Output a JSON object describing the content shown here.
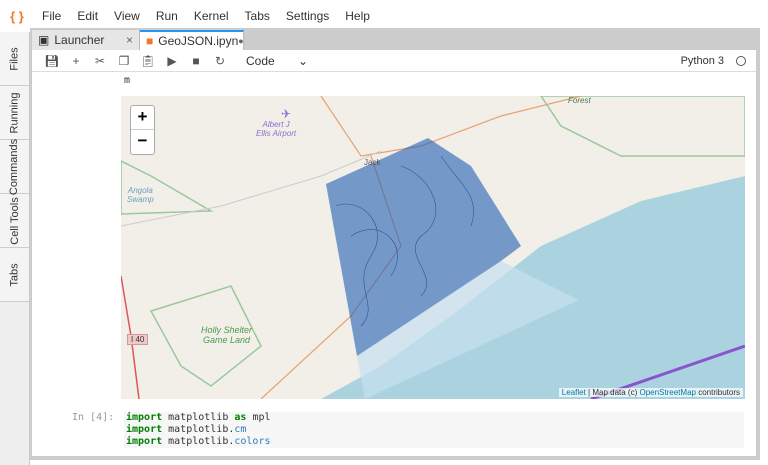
{
  "menubar": {
    "items": [
      "File",
      "Edit",
      "View",
      "Run",
      "Kernel",
      "Tabs",
      "Settings",
      "Help"
    ]
  },
  "sidebar": {
    "tabs": [
      "Files",
      "Running",
      "Commands",
      "Cell Tools",
      "Tabs"
    ]
  },
  "tabs": [
    {
      "label": "Launcher",
      "close": "×"
    },
    {
      "label": "GeoJSON.ipyn",
      "modified": "●"
    }
  ],
  "toolbar": {
    "cell_type": "Code",
    "kernel": "Python 3",
    "icons": [
      "save-icon",
      "add-icon",
      "cut-icon",
      "copy-icon",
      "paste-icon",
      "run-icon",
      "stop-icon",
      "restart-icon"
    ]
  },
  "output": {
    "text": "m"
  },
  "map": {
    "zoom_in": "+",
    "zoom_out": "−",
    "labels": {
      "airport": "Albert J\nEllis Airport",
      "swamp": "Angola\nSwamp",
      "game_land": "Holly Shelter\nGame Land",
      "forest": "Forest",
      "town": "Jack",
      "highway": "I 40"
    },
    "attribution": {
      "leaflet": "Leaflet",
      "sep": " | Map data (c) ",
      "osm": "OpenStreetMap",
      "suffix": " contributors"
    },
    "colors": {
      "land": "#f2efe9",
      "sea": "#aad3df",
      "overlay": "#1f5fb4"
    }
  },
  "cell": {
    "prompt": "In [4]:",
    "lines": [
      [
        "import",
        " matplotlib ",
        "as",
        " mpl"
      ],
      [
        "import",
        " matplotlib.",
        "cm"
      ],
      [
        "import",
        " matplotlib.",
        "colors"
      ]
    ]
  }
}
